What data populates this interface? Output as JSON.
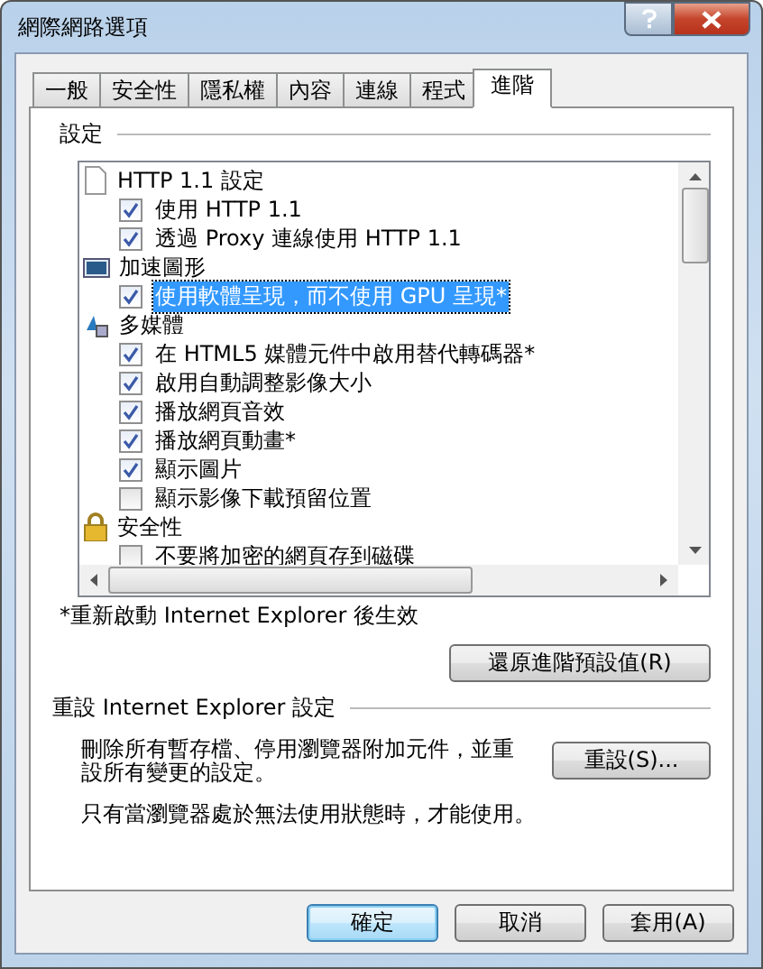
{
  "window": {
    "title": "網際網路選項"
  },
  "tabs": [
    {
      "label": "一般",
      "selected": false
    },
    {
      "label": "安全性",
      "selected": false
    },
    {
      "label": "隱私權",
      "selected": false
    },
    {
      "label": "內容",
      "selected": false
    },
    {
      "label": "連線",
      "selected": false
    },
    {
      "label": "程式",
      "selected": false
    },
    {
      "label": "進階",
      "selected": true
    }
  ],
  "settings": {
    "label": "設定",
    "tree": [
      {
        "label": "HTTP 1.1 設定",
        "kind": "page",
        "children": [
          {
            "label": "使用 HTTP 1.1",
            "checked": true,
            "selected": false
          },
          {
            "label": "透過 Proxy 連線使用 HTTP 1.1",
            "checked": true,
            "selected": false
          }
        ]
      },
      {
        "label": "加速圖形",
        "kind": "graphics",
        "children": [
          {
            "label": "使用軟體呈現，而不使用 GPU 呈現*",
            "checked": true,
            "selected": true
          }
        ]
      },
      {
        "label": "多媒體",
        "kind": "media",
        "children": [
          {
            "label": "在 HTML5 媒體元件中啟用替代轉碼器*",
            "checked": true,
            "selected": false
          },
          {
            "label": "啟用自動調整影像大小",
            "checked": true,
            "selected": false
          },
          {
            "label": "播放網頁音效",
            "checked": true,
            "selected": false
          },
          {
            "label": "播放網頁動畫*",
            "checked": true,
            "selected": false
          },
          {
            "label": "顯示圖片",
            "checked": true,
            "selected": false
          },
          {
            "label": "顯示影像下載預留位置",
            "checked": false,
            "selected": false
          }
        ]
      },
      {
        "label": "安全性",
        "kind": "lock",
        "children": [
          {
            "label": "不要將加密的網頁存到磁碟",
            "checked": false,
            "selected": false
          }
        ]
      }
    ],
    "footnote": "*重新啟動 Internet Explorer 後生效",
    "restore_button": "還原進階預設值(R)"
  },
  "reset": {
    "label": "重設 Internet Explorer 設定",
    "description": "刪除所有暫存檔、停用瀏覽器附加元件，並重設所有變更的設定。",
    "button": "重設(S)...",
    "note": "只有當瀏覽器處於無法使用狀態時，才能使用。"
  },
  "buttons": [
    {
      "label": "確定",
      "default": true
    },
    {
      "label": "取消",
      "default": false
    },
    {
      "label": "套用(A)",
      "default": false
    }
  ]
}
